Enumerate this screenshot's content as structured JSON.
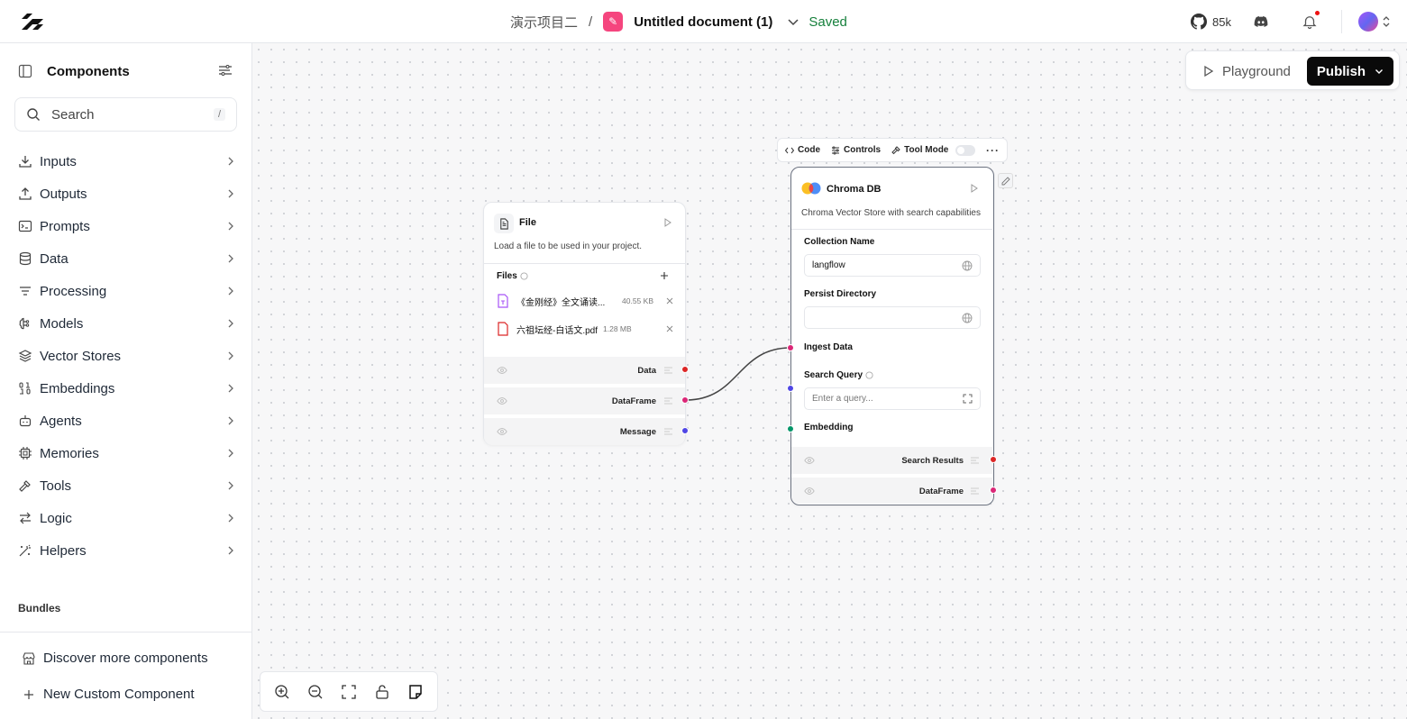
{
  "header": {
    "project": "演示项目二",
    "separator": "/",
    "document_title": "Untitled document (1)",
    "status": "Saved",
    "github_stars": "85k",
    "colors": {
      "flow_icon": "#f5457e",
      "saved": "#16803c"
    }
  },
  "sidebar": {
    "title": "Components",
    "search_placeholder": "Search",
    "search_shortcut": "/",
    "categories": [
      {
        "label": "Inputs",
        "icon": "download-icon"
      },
      {
        "label": "Outputs",
        "icon": "upload-icon"
      },
      {
        "label": "Prompts",
        "icon": "terminal-icon"
      },
      {
        "label": "Data",
        "icon": "database-icon"
      },
      {
        "label": "Processing",
        "icon": "list-filter-icon"
      },
      {
        "label": "Models",
        "icon": "brain-icon"
      },
      {
        "label": "Vector Stores",
        "icon": "layers-icon"
      },
      {
        "label": "Embeddings",
        "icon": "binary-icon"
      },
      {
        "label": "Agents",
        "icon": "bot-icon"
      },
      {
        "label": "Memories",
        "icon": "cpu-icon"
      },
      {
        "label": "Tools",
        "icon": "hammer-icon"
      },
      {
        "label": "Logic",
        "icon": "arrows-icon"
      },
      {
        "label": "Helpers",
        "icon": "wand-icon"
      }
    ],
    "bundles_label": "Bundles",
    "footer": {
      "discover": "Discover more components",
      "new_custom": "New Custom Component"
    }
  },
  "canvas": {
    "playground_label": "Playground",
    "publish_label": "Publish"
  },
  "file_node": {
    "title": "File",
    "description": "Load a file to be used in your project.",
    "files_label": "Files",
    "files": [
      {
        "name": "《金刚经》全文诵读...",
        "size": "40.55 KB"
      },
      {
        "name": "六祖坛经-白话文.pdf",
        "size": "1.28 MB"
      }
    ],
    "outputs": [
      "Data",
      "DataFrame",
      "Message"
    ]
  },
  "chroma_node": {
    "toolbar": {
      "code": "Code",
      "controls": "Controls",
      "tool_mode": "Tool Mode"
    },
    "title": "Chroma DB",
    "description": "Chroma Vector Store with search capabilities",
    "collection_name_label": "Collection Name",
    "collection_name_value": "langflow",
    "persist_directory_label": "Persist Directory",
    "persist_directory_value": "",
    "ingest_data_label": "Ingest Data",
    "search_query_label": "Search Query",
    "search_query_placeholder": "Enter a query...",
    "embedding_label": "Embedding",
    "outputs": [
      "Search Results",
      "DataFrame"
    ]
  },
  "handle_colors": {
    "data": "#dc2626",
    "dataframe": "#db2777",
    "message": "#4f46e5",
    "embedding": "#059669"
  }
}
